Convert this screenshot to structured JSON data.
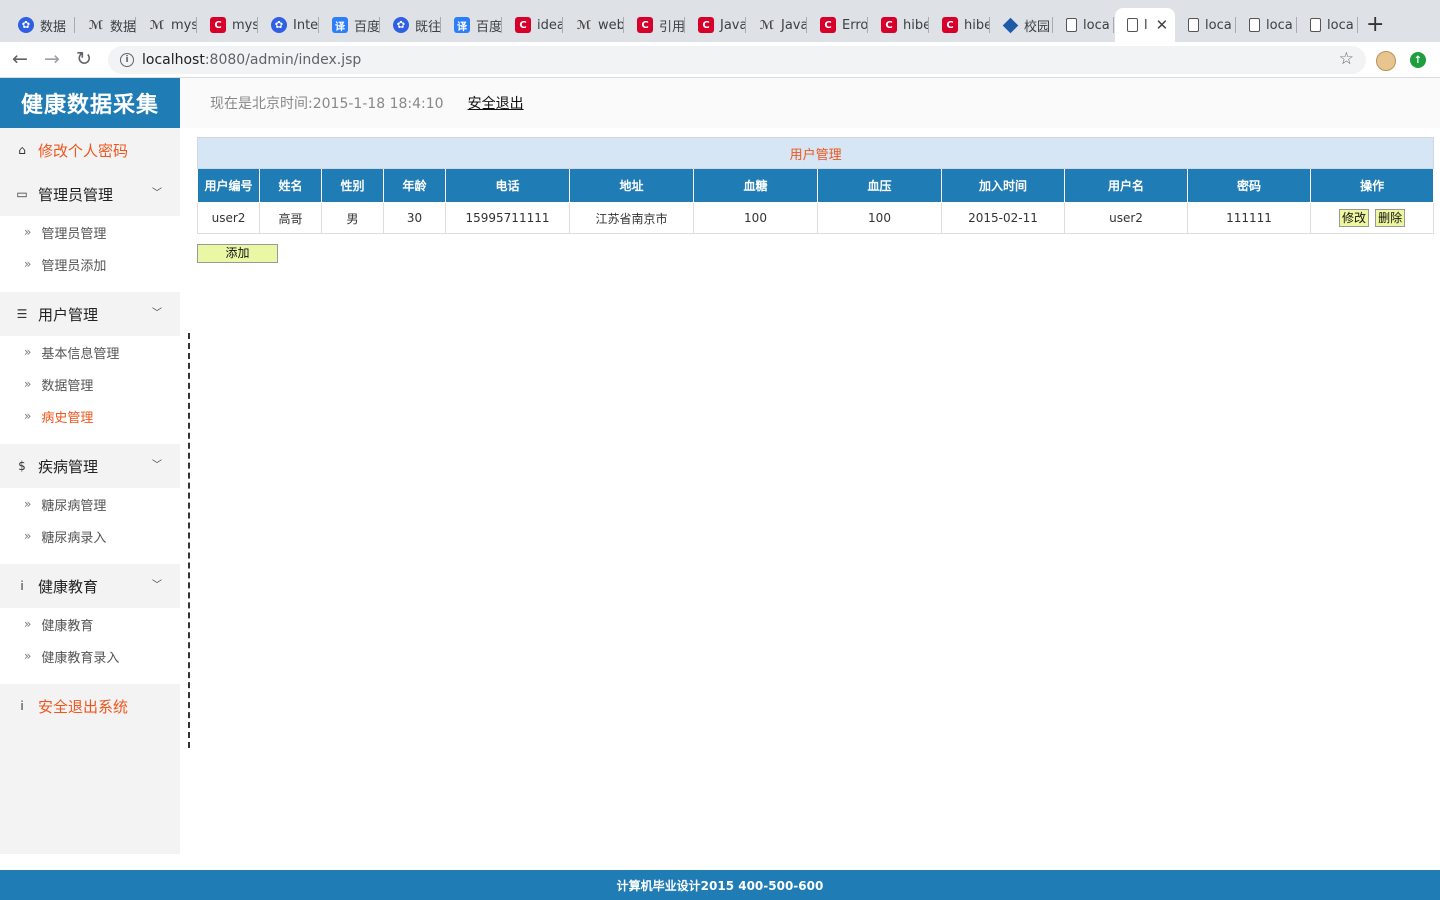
{
  "browser": {
    "tabs": [
      {
        "title": "数据",
        "icon": "baidu"
      },
      {
        "title": "数据",
        "icon": "wiki"
      },
      {
        "title": "mys",
        "icon": "wiki"
      },
      {
        "title": "mys",
        "icon": "red"
      },
      {
        "title": "Inte",
        "icon": "baidu"
      },
      {
        "title": "百度",
        "icon": "fanyi"
      },
      {
        "title": "既往",
        "icon": "baidu"
      },
      {
        "title": "百度",
        "icon": "fanyi"
      },
      {
        "title": "idea",
        "icon": "red"
      },
      {
        "title": "web",
        "icon": "wiki"
      },
      {
        "title": "引用",
        "icon": "red"
      },
      {
        "title": "Java",
        "icon": "red"
      },
      {
        "title": "Java",
        "icon": "wiki"
      },
      {
        "title": "Erro",
        "icon": "red"
      },
      {
        "title": "hibe",
        "icon": "red"
      },
      {
        "title": "hibe",
        "icon": "red"
      },
      {
        "title": "校园",
        "icon": "globe"
      },
      {
        "title": "loca",
        "icon": "doc"
      },
      {
        "title": "l",
        "icon": "doc",
        "active": true
      },
      {
        "title": "loca",
        "icon": "doc"
      },
      {
        "title": "loca",
        "icon": "doc"
      },
      {
        "title": "loca",
        "icon": "doc"
      }
    ],
    "url_host": "localhost",
    "url_path": ":8080/admin/index.jsp"
  },
  "header": {
    "logo": "健康数据采集",
    "clock": "现在是北京时间:2015-1-18 18:4:10",
    "logout": "安全退出"
  },
  "sidebar": {
    "change_password": "修改个人密码",
    "sections": [
      {
        "title": "管理员管理",
        "icon": "inbox-icon",
        "glyph": "▭",
        "items": [
          {
            "label": "管理员管理"
          },
          {
            "label": "管理员添加"
          }
        ]
      },
      {
        "title": "用户管理",
        "icon": "list-icon",
        "glyph": "☰",
        "items": [
          {
            "label": "基本信息管理"
          },
          {
            "label": "数据管理"
          },
          {
            "label": "病史管理",
            "active": true
          }
        ]
      },
      {
        "title": "疾病管理",
        "icon": "dollar-icon",
        "glyph": "$",
        "items": [
          {
            "label": "糖尿病管理"
          },
          {
            "label": "糖尿病录入"
          }
        ]
      },
      {
        "title": "健康教育",
        "icon": "info-icon",
        "glyph": "i",
        "items": [
          {
            "label": "健康教育"
          },
          {
            "label": "健康教育录入"
          }
        ]
      }
    ],
    "exit": "安全退出系统"
  },
  "table": {
    "caption": "用户管理",
    "columns": [
      "用户编号",
      "姓名",
      "性别",
      "年龄",
      "电话",
      "地址",
      "血糖",
      "血压",
      "加入时间",
      "用户名",
      "密码",
      "操作"
    ],
    "rows": [
      {
        "cells": [
          "user2",
          "高哥",
          "男",
          "30",
          "15995711111",
          "江苏省南京市",
          "100",
          "100",
          "2015-02-11",
          "user2",
          "111111"
        ],
        "edit": "修改",
        "delete": "删除"
      }
    ],
    "add_label": "添加"
  },
  "footer": {
    "text": "计算机毕业设计2015  400-500-600"
  },
  "colors": {
    "primary": "#1f7cb4",
    "accent": "#f0561d",
    "caption_bg": "#d6e6f4",
    "button_bg": "#eef7a0"
  }
}
